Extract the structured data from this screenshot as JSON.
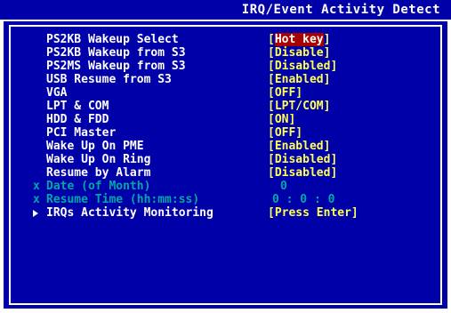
{
  "header": {
    "title": "IRQ/Event Activity Detect"
  },
  "items": [
    {
      "label": "PS2KB Wakeup Select",
      "value": "Hot key",
      "bracket_open": "[",
      "bracket_close": "]"
    },
    {
      "label": "PS2KB Wakeup from S3",
      "value": "[Disable]"
    },
    {
      "label": "PS2MS Wakeup from S3",
      "value": "[Disabled]"
    },
    {
      "label": "USB Resume from S3",
      "value": "[Enabled]"
    },
    {
      "label": "VGA",
      "value": "[OFF]"
    },
    {
      "label": "LPT & COM",
      "value": "[LPT/COM]"
    },
    {
      "label": "HDD & FDD",
      "value": "[ON]"
    },
    {
      "label": "PCI Master",
      "value": "[OFF]"
    },
    {
      "label": "Wake Up On PME",
      "value": "[Enabled]"
    },
    {
      "label": "Wake Up On Ring",
      "value": "[Disabled]"
    },
    {
      "label": "Resume by Alarm",
      "value": "[Disabled]"
    },
    {
      "label": "Date (of Month)",
      "value": "0",
      "marker": "x"
    },
    {
      "label": "Resume Time (hh:mm:ss)",
      "value": "0 : 0 : 0",
      "marker": "x"
    },
    {
      "label": "IRQs Activity Monitoring",
      "value": "[Press Enter]"
    }
  ],
  "colors": {
    "background": "#0000a8",
    "label": "#ffffff",
    "value": "#ffff55",
    "selected_bg": "#a80000",
    "disabled": "#00a8a8"
  }
}
